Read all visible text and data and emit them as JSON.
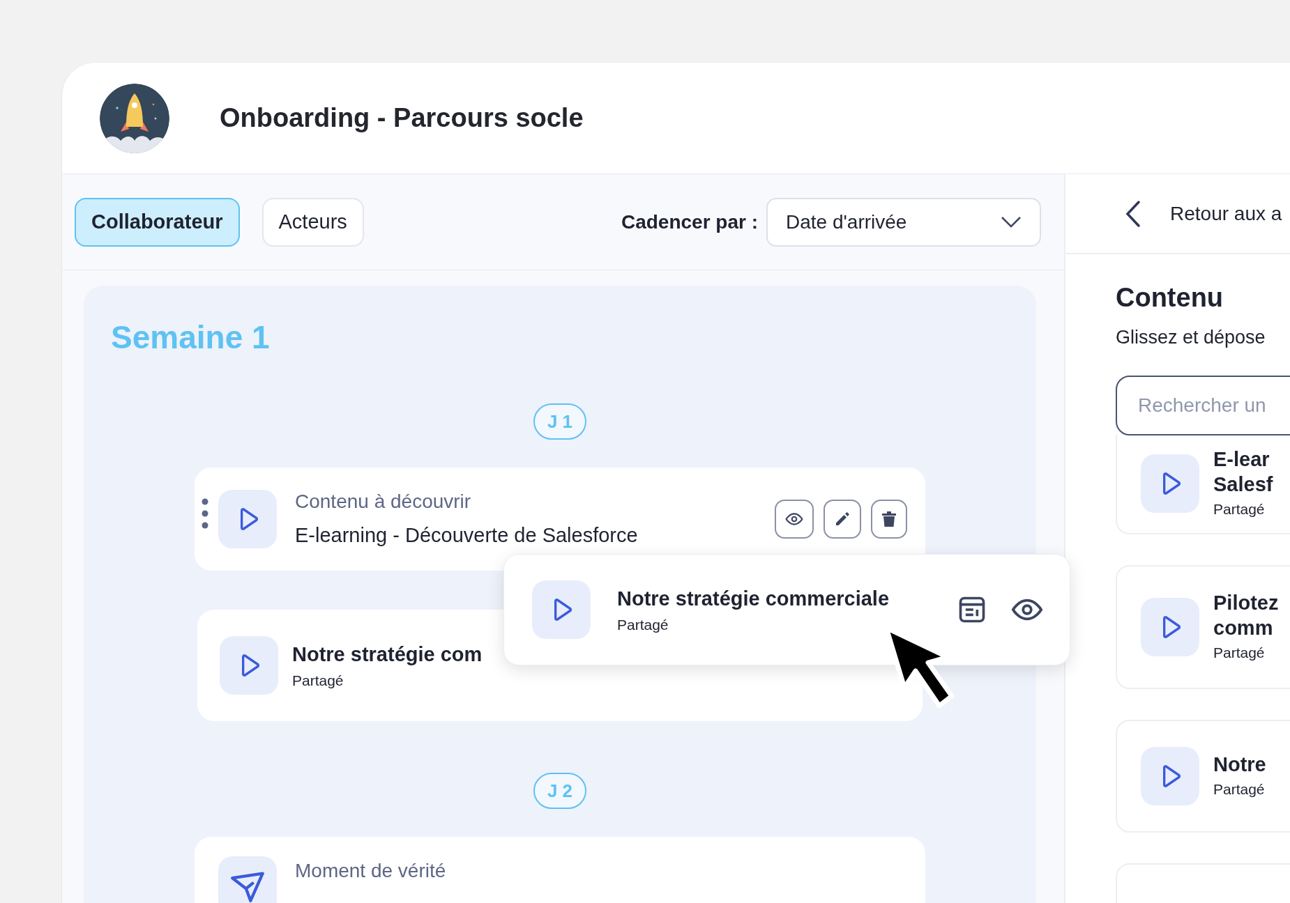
{
  "header": {
    "title": "Onboarding - Parcours socle"
  },
  "tabs": [
    {
      "label": "Collaborateur",
      "selected": true
    },
    {
      "label": "Acteurs",
      "selected": false
    }
  ],
  "cadence": {
    "label": "Cadencer par :",
    "value": "Date d'arrivée"
  },
  "week": {
    "title": "Semaine 1",
    "days": [
      {
        "label": "J 1",
        "items": [
          {
            "kind": "step",
            "category": "Contenu à découvrir",
            "title": "E-learning - Découverte de Salesforce"
          },
          {
            "kind": "content",
            "title": "Notre stratégie com",
            "status": "Partagé"
          }
        ]
      },
      {
        "label": "J 2",
        "items": [
          {
            "kind": "moment",
            "category": "Moment de vérité"
          }
        ]
      }
    ]
  },
  "dragged": {
    "title": "Notre stratégie commerciale",
    "status": "Partagé"
  },
  "panel": {
    "back": "Retour aux a",
    "title": "Contenu",
    "subtitle": "Glissez et dépose",
    "search": {
      "placeholder": "Rechercher un"
    },
    "items": [
      {
        "title_lines": [
          "E-lear",
          "Salesf"
        ],
        "status": "Partagé"
      },
      {
        "title_lines": [
          "Pilotez",
          "comm"
        ],
        "status": "Partagé"
      },
      {
        "title_lines": [
          "Notre"
        ],
        "status": "Partagé"
      }
    ]
  }
}
